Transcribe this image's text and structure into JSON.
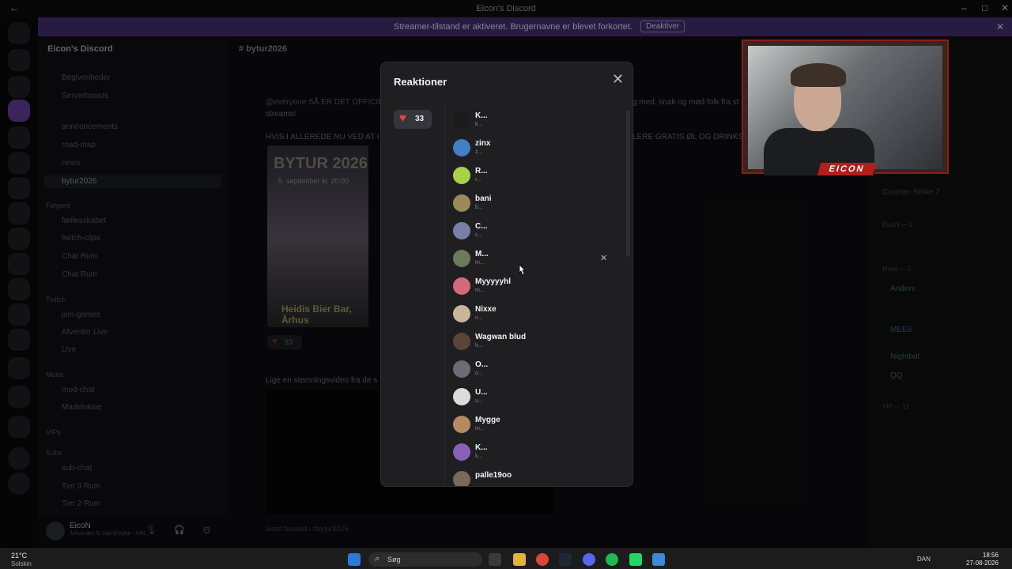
{
  "window": {
    "title": "Eicon's Discord"
  },
  "banner": {
    "message": "Streamer-tilstand er aktiveret. Brugernavne er blevet forkortet.",
    "button": "Deaktiver",
    "close_icon": "close-icon"
  },
  "sidebar": {
    "server_name": "Eicon's Discord",
    "top_items": [
      "Begivenheder",
      "Serverboosts"
    ],
    "channels": [
      "announcements",
      "road-map",
      "news",
      "bytur2026"
    ],
    "selected_channel": "bytur2026",
    "categories": [
      {
        "label": "Følgere",
        "channels": [
          "fællesskabet",
          "twitch-clips",
          "Chat Rum",
          "Chat Rum"
        ]
      },
      {
        "label": "Twitch",
        "channels": [
          "join-games",
          "Afventer Live",
          "Live"
        ]
      },
      {
        "label": "Mods",
        "channels": [
          "mod-chat",
          "Madeloksie"
        ]
      },
      {
        "label": "VIPs",
        "channels": []
      },
      {
        "label": "Subs",
        "channels": [
          "sub-chat",
          "Tier 3 Rum",
          "Tier 2 Rum"
        ]
      }
    ]
  },
  "user": {
    "name": "EicoN",
    "status": "Århus den 5. sep til bytur - VIN..."
  },
  "channel_header": {
    "name": "bytur2026"
  },
  "messages": {
    "line1": "@everyone SÅ ER DET OFFICIE",
    "line2": "streams!",
    "line3": "HVIS I ALLEREDE NU VED AT I",
    "line4": "Lige en stemningsvideo fra de s",
    "tail1": "g med, snak og mød folk fra st",
    "tail2": "LERE GRATIS ØL OG DRINKS B",
    "reaction_count": "33",
    "input_placeholder": "Send besked i #bytur2026"
  },
  "poster": {
    "title": "BYTUR 2026",
    "date": "5. september kl. 20:00",
    "venue": "Heidis Bier Bar, Århus"
  },
  "members": {
    "game": "Counter-Strike 2",
    "group1": "EicoN — 1",
    "group2": "Mods — 5",
    "group3": "VIP — 11",
    "names": [
      "Anders",
      "MEE6",
      "Nightbot",
      "QQ"
    ]
  },
  "modal": {
    "title": "Reaktioner",
    "close_icon": "close-icon",
    "reaction": {
      "emoji": "heart-icon",
      "count": "33"
    },
    "users": [
      {
        "name": "K...",
        "sub": "k...",
        "color": "#1b1b1b"
      },
      {
        "name": "zinx",
        "sub": "z...",
        "color": "#3f7fc2"
      },
      {
        "name": "R...",
        "sub": "r...",
        "color": "#a8d14a"
      },
      {
        "name": "bani",
        "sub": "b...",
        "color": "#9c8a5b"
      },
      {
        "name": "C...",
        "sub": "c...",
        "color": "#7a7fa6"
      },
      {
        "name": "M...",
        "sub": "m...",
        "color": "#6c7a5c"
      },
      {
        "name": "Myyyyyhl",
        "sub": "m...",
        "color": "#d46b7a"
      },
      {
        "name": "Nixxe",
        "sub": "n...",
        "color": "#c9b59a"
      },
      {
        "name": "Wagwan blud",
        "sub": "h...",
        "color": "#5a4638"
      },
      {
        "name": "O...",
        "sub": "o...",
        "color": "#6a6d75"
      },
      {
        "name": "U...",
        "sub": "u...",
        "color": "#dcdcdc"
      },
      {
        "name": "Mygge",
        "sub": "m...",
        "color": "#b58a63"
      },
      {
        "name": "K...",
        "sub": "k...",
        "color": "#8a5fb8"
      },
      {
        "name": "palle19oo",
        "sub": "",
        "color": "#7a6a5a"
      }
    ],
    "remove_icon": "close-icon"
  },
  "webcam": {
    "tag": "EICON"
  },
  "taskbar": {
    "weather_temp": "21°C",
    "weather_desc": "Solskin",
    "search_label": "Søg",
    "lang": "DAN",
    "time": "18:56",
    "date": "27-08-2026"
  }
}
